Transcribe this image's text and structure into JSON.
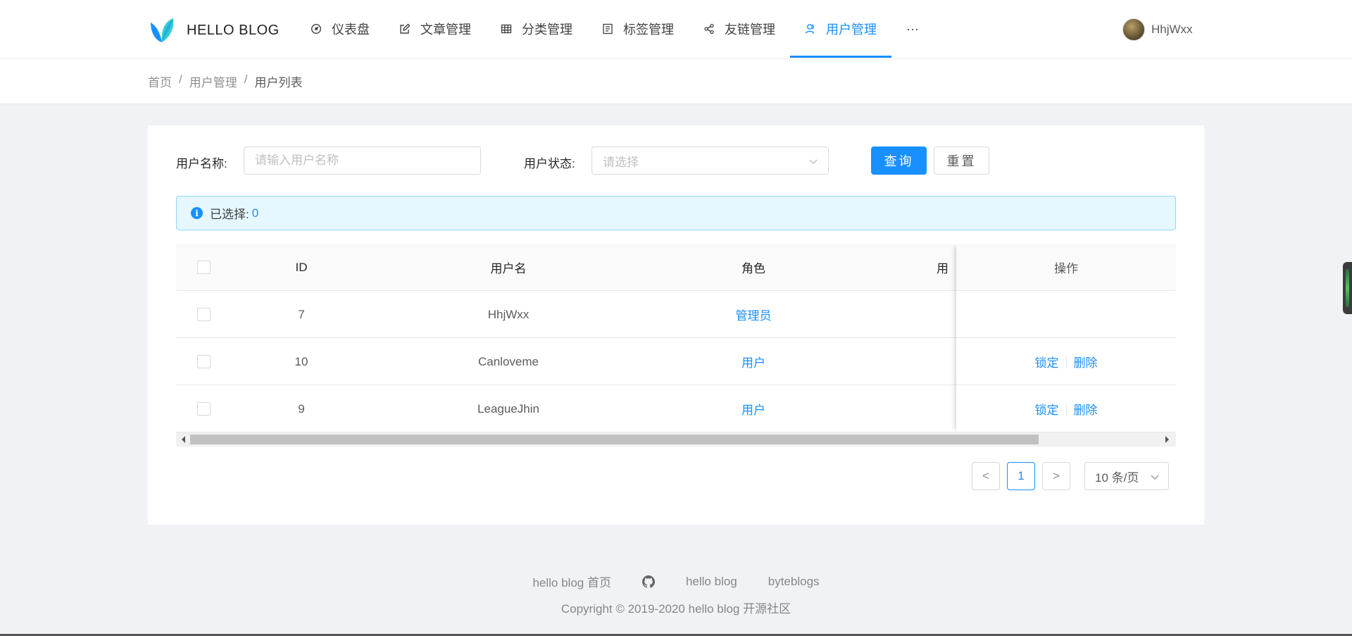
{
  "brand": {
    "name": "HELLO BLOG"
  },
  "nav": {
    "items": [
      {
        "label": "仪表盘",
        "icon": "dashboard-icon"
      },
      {
        "label": "文章管理",
        "icon": "edit-icon"
      },
      {
        "label": "分类管理",
        "icon": "table-icon"
      },
      {
        "label": "标签管理",
        "icon": "list-icon"
      },
      {
        "label": "友链管理",
        "icon": "share-icon"
      },
      {
        "label": "用户管理",
        "icon": "user-icon",
        "active": true
      }
    ],
    "more": "···"
  },
  "user": {
    "name": "HhjWxx"
  },
  "breadcrumb": {
    "home": "首页",
    "section": "用户管理",
    "current": "用户列表",
    "separator": "/"
  },
  "filters": {
    "username_label": "用户名称:",
    "username_placeholder": "请输入用户名称",
    "status_label": "用户状态:",
    "status_placeholder": "请选择",
    "search_button": "查询",
    "reset_button": "重置"
  },
  "alert": {
    "text": "已选择:",
    "count": "0"
  },
  "table": {
    "columns": {
      "id": "ID",
      "username": "用户名",
      "role": "角色",
      "hidden_partial": "用",
      "actions": "操作"
    },
    "rows": [
      {
        "id": "7",
        "username": "HhjWxx",
        "role": "管理员",
        "lock": "",
        "delete": ""
      },
      {
        "id": "10",
        "username": "Canloveme",
        "role": "用户",
        "lock": "锁定",
        "delete": "删除"
      },
      {
        "id": "9",
        "username": "LeagueJhin",
        "role": "用户",
        "lock": "锁定",
        "delete": "删除"
      }
    ]
  },
  "pagination": {
    "prev": "<",
    "current": "1",
    "next": ">",
    "page_size": "10 条/页"
  },
  "footer": {
    "links": [
      "hello blog 首页",
      "hello blog",
      "byteblogs"
    ],
    "github_icon": "github-icon",
    "copyright": "Copyright © 2019-2020 hello blog 开源社区"
  },
  "colors": {
    "primary": "#1890ff",
    "background": "#f0f2f5"
  }
}
